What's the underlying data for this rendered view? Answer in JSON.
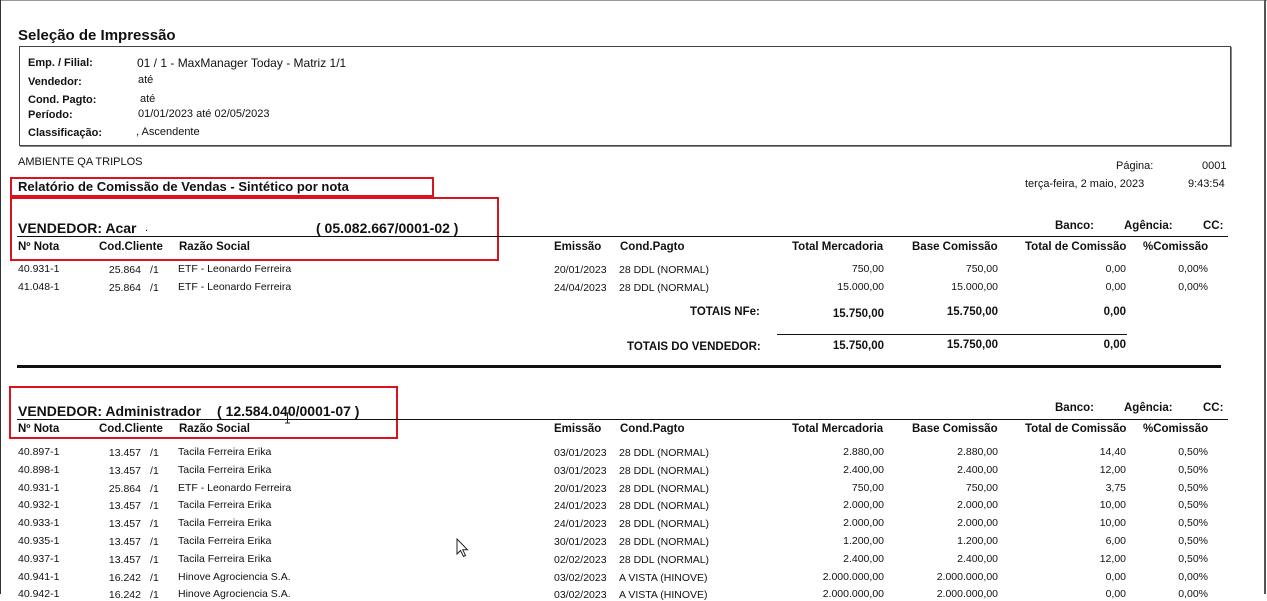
{
  "header": {
    "title": "Seleção de Impressão",
    "fields": [
      {
        "label": "Emp. / Filial:",
        "value": "01 / 1 - MaxManager Today - Matriz 1/1"
      },
      {
        "label": "Vendedor:",
        "value": "até"
      },
      {
        "label": "Cond. Pagto:",
        "value": "até"
      },
      {
        "label": "Período:",
        "value": "01/01/2023 até 02/05/2023"
      },
      {
        "label": "Classificação:",
        "value": ", Ascendente"
      }
    ]
  },
  "report": {
    "environment": "AMBIENTE QA TRIPLOS",
    "title": "Relatório de Comissão de Vendas - Sintético por nota",
    "page_label": "Página:",
    "page_number": "0001",
    "date": "terça-feira, 2 maio, 2023",
    "time": "9:43:54"
  },
  "bank_labels": {
    "banco": "Banco:",
    "agencia": "Agência:",
    "cc": "CC:"
  },
  "columns": [
    "Nº Nota",
    "Cod.Cliente",
    "Razão Social",
    "Emissão",
    "Cond.Pagto",
    "Total Mercadoria",
    "Base Comissão",
    "Total de Comissão",
    "%Comissão"
  ],
  "vendors": [
    {
      "title": "VENDEDOR: Acar",
      "dot": ".",
      "cnpj": "( 05.082.667/0001-02 )",
      "rows": [
        [
          "40.931-1",
          "25.864",
          "1",
          "ETF - Leonardo Ferreira",
          "20/01/2023",
          "28 DDL (NORMAL)",
          "750,00",
          "750,00",
          "0,00",
          "0,00%"
        ],
        [
          "41.048-1",
          "25.864",
          "1",
          "ETF - Leonardo Ferreira",
          "24/04/2023",
          "28 DDL (NORMAL)",
          "15.000,00",
          "15.000,00",
          "0,00",
          "0,00%"
        ]
      ],
      "totals_nfe": {
        "label": "TOTAIS NFe:",
        "mercadoria": "15.750,00",
        "base": "15.750,00",
        "comissao": "0,00"
      },
      "totals_vendor": {
        "label": "TOTAIS DO VENDEDOR:",
        "mercadoria": "15.750,00",
        "base": "15.750,00",
        "comissao": "0,00"
      }
    },
    {
      "title": "VENDEDOR: Administrador",
      "cnpj": "( 12.584.040/0001-07 )",
      "rows": [
        [
          "40.897-1",
          "13.457",
          "1",
          "Tacila Ferreira Erika",
          "03/01/2023",
          "28 DDL (NORMAL)",
          "2.880,00",
          "2.880,00",
          "14,40",
          "0,50%"
        ],
        [
          "40.898-1",
          "13.457",
          "1",
          "Tacila Ferreira Erika",
          "03/01/2023",
          "28 DDL (NORMAL)",
          "2.400,00",
          "2.400,00",
          "12,00",
          "0,50%"
        ],
        [
          "40.931-1",
          "25.864",
          "1",
          "ETF - Leonardo Ferreira",
          "20/01/2023",
          "28 DDL (NORMAL)",
          "750,00",
          "750,00",
          "3,75",
          "0,50%"
        ],
        [
          "40.932-1",
          "13.457",
          "1",
          "Tacila Ferreira Erika",
          "24/01/2023",
          "28 DDL (NORMAL)",
          "2.000,00",
          "2.000,00",
          "10,00",
          "0,50%"
        ],
        [
          "40.933-1",
          "13.457",
          "1",
          "Tacila Ferreira Erika",
          "24/01/2023",
          "28 DDL (NORMAL)",
          "2.000,00",
          "2.000,00",
          "10,00",
          "0,50%"
        ],
        [
          "40.935-1",
          "13.457",
          "1",
          "Tacila Ferreira Erika",
          "30/01/2023",
          "28 DDL (NORMAL)",
          "1.200,00",
          "1.200,00",
          "6,00",
          "0,50%"
        ],
        [
          "40.937-1",
          "13.457",
          "1",
          "Tacila Ferreira Erika",
          "02/02/2023",
          "28 DDL (NORMAL)",
          "2.400,00",
          "2.400,00",
          "12,00",
          "0,50%"
        ],
        [
          "40.941-1",
          "16.242",
          "1",
          "Hinove Agrociencia S.A.",
          "03/02/2023",
          "A VISTA (HINOVE)",
          "2.000.000,00",
          "2.000.000,00",
          "0,00",
          "0,00%"
        ],
        [
          "40.942-1",
          "16.242",
          "1",
          "Hinove Agrociencia S.A.",
          "03/02/2023",
          "A VISTA (HINOVE)",
          "2.000.000,00",
          "2.000.000,00",
          "0,00",
          "0,00%"
        ]
      ]
    }
  ]
}
